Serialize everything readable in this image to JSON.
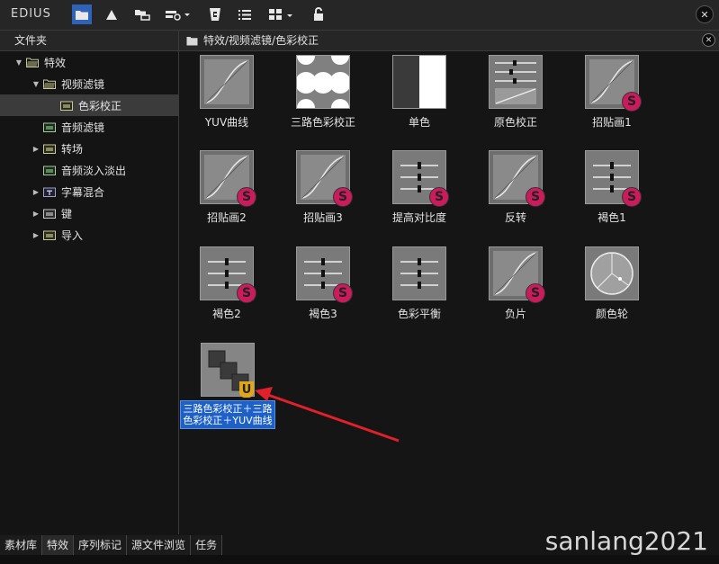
{
  "app": {
    "logo": "EDIUS"
  },
  "folder_panel": {
    "title": "文件夹",
    "tree": [
      {
        "label": "特效",
        "expanded": true
      },
      {
        "label": "视频滤镜",
        "expanded": true
      },
      {
        "label": "色彩校正",
        "selected": true
      },
      {
        "label": "音频滤镜"
      },
      {
        "label": "转场",
        "collapsed": true
      },
      {
        "label": "音频淡入淡出"
      },
      {
        "label": "字幕混合",
        "collapsed": true
      },
      {
        "label": "键",
        "collapsed": true
      },
      {
        "label": "导入",
        "collapsed": true
      }
    ]
  },
  "content_panel": {
    "path": "特效/视频滤镜/色彩校正",
    "items": [
      {
        "label": "YUV曲线",
        "icon": "curve-icon"
      },
      {
        "label": "三路色彩校正",
        "icon": "three-way-icon"
      },
      {
        "label": "单色",
        "icon": "monochrome-icon"
      },
      {
        "label": "原色校正",
        "icon": "primary-color-icon"
      },
      {
        "label": "招贴画1",
        "icon": "curve-icon",
        "badge": "S"
      },
      {
        "label": "招贴画2",
        "icon": "curve-icon",
        "badge": "S"
      },
      {
        "label": "招贴画3",
        "icon": "curve-icon",
        "badge": "S"
      },
      {
        "label": "提高对比度",
        "icon": "sliders-icon",
        "badge": "S"
      },
      {
        "label": "反转",
        "icon": "curve-icon",
        "badge": "S"
      },
      {
        "label": "褐色1",
        "icon": "sliders-icon",
        "badge": "S"
      },
      {
        "label": "褐色2",
        "icon": "sliders-icon",
        "badge": "S"
      },
      {
        "label": "褐色3",
        "icon": "sliders-icon",
        "badge": "S"
      },
      {
        "label": "色彩平衡",
        "icon": "sliders-icon"
      },
      {
        "label": "负片",
        "icon": "curve-icon",
        "badge": "S"
      },
      {
        "label": "颜色轮",
        "icon": "color-wheel-icon"
      },
      {
        "label": "三路色彩校正＋三路色彩校正＋YUV曲线",
        "icon": "layers-icon",
        "badge": "U",
        "selected": true
      }
    ]
  },
  "bottom_tabs": [
    {
      "label": "素材库"
    },
    {
      "label": "特效",
      "active": true
    },
    {
      "label": "序列标记"
    },
    {
      "label": "源文件浏览"
    },
    {
      "label": "任务"
    }
  ],
  "watermark": "sanlang2021",
  "colors": {
    "accent": "#2f63b8",
    "selection": "#1c60c8",
    "badge_s": "#cc1b5d",
    "badge_u": "#e1a51a",
    "arrow": "#e0202a"
  }
}
